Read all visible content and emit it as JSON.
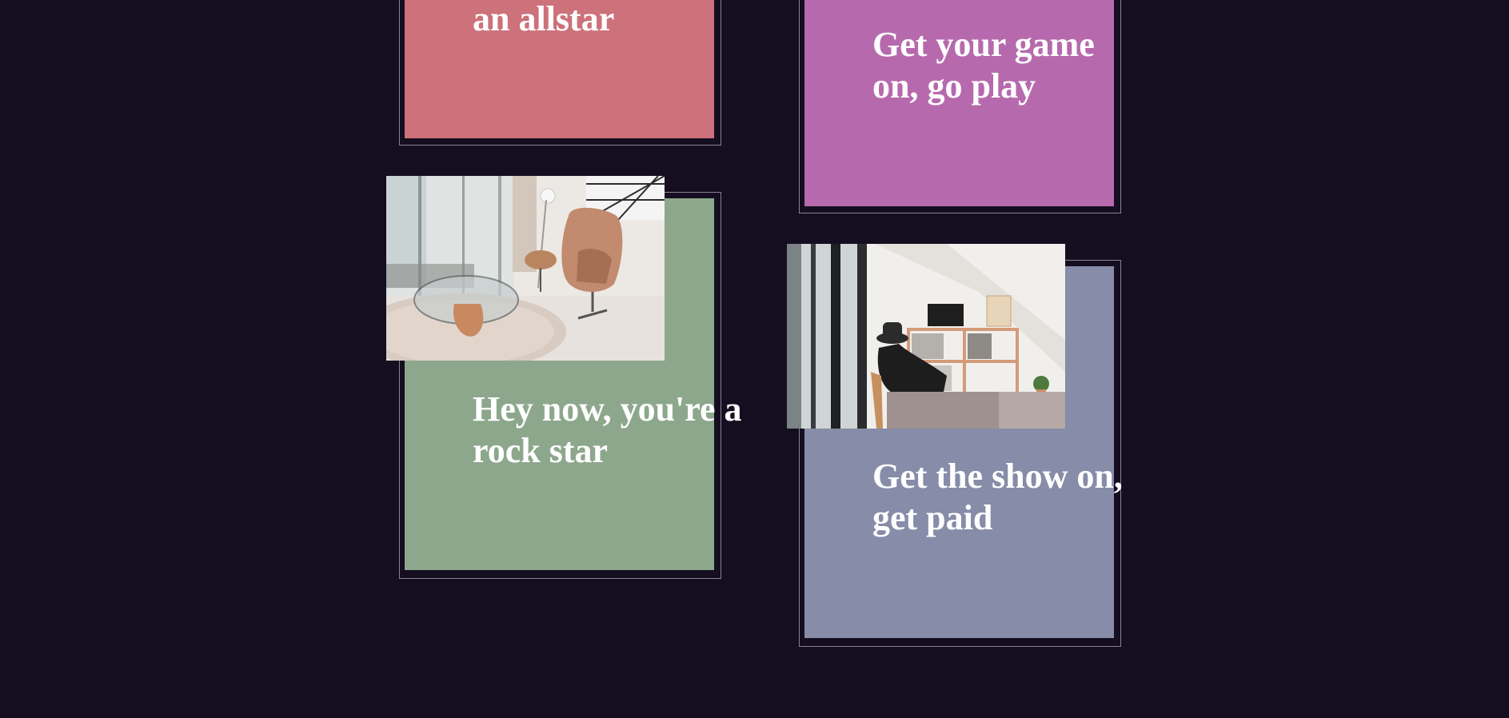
{
  "colors": {
    "background": "#150e20",
    "card_pink": "#cd717a",
    "card_purple": "#b66aad",
    "card_green": "#8da78d",
    "card_slate": "#878ca8"
  },
  "cards": [
    {
      "text": "an allstar"
    },
    {
      "text_line1": "Get your game",
      "text_line2": "on, go play"
    },
    {
      "text_line1": "Hey now, you're a",
      "text_line2": "rock star",
      "image": "living-room-egg-chair-photo"
    },
    {
      "text_line1": "Get the show on,",
      "text_line2": "get paid",
      "image": "person-at-bookshelf-photo"
    }
  ]
}
